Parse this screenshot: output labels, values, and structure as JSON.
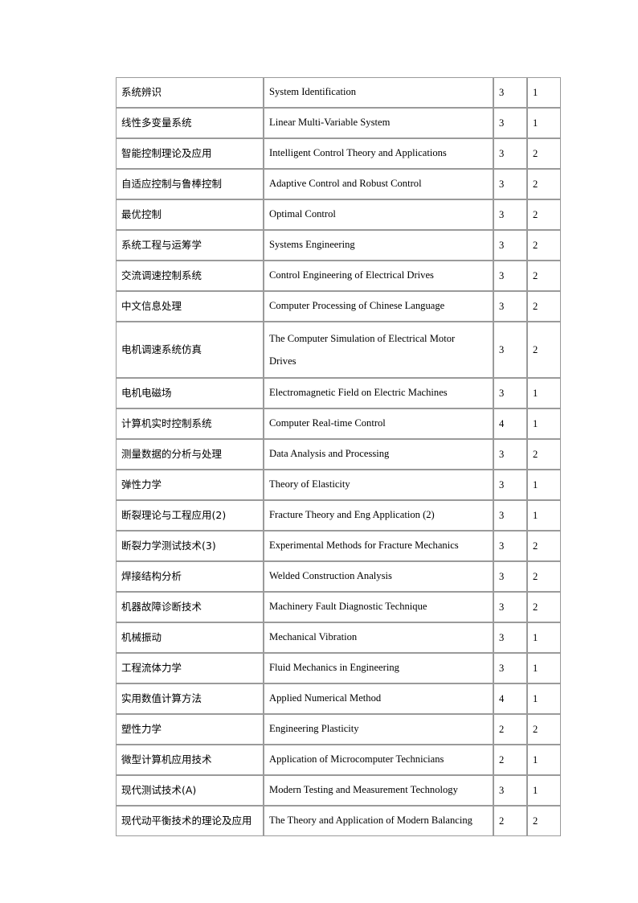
{
  "document": {
    "type": "course-catalog-table",
    "page_background": "#ffffff",
    "text_color": "#000000",
    "border_color": "#9a9a9a"
  },
  "table": {
    "name": "graduate-course-list",
    "columns": [
      {
        "key": "name_cn",
        "role": "course-name-chinese"
      },
      {
        "key": "name_en",
        "role": "course-name-english"
      },
      {
        "key": "credits",
        "role": "credit-hours"
      },
      {
        "key": "term",
        "role": "term"
      }
    ],
    "rows": [
      {
        "name_cn": "系统辨识",
        "name_en": "System Identification",
        "credits": "3",
        "term": "1",
        "tall": false
      },
      {
        "name_cn": "线性多变量系统",
        "name_en": "Linear Multi-Variable System",
        "credits": "3",
        "term": "1",
        "tall": false
      },
      {
        "name_cn": "智能控制理论及应用",
        "name_en": "Intelligent Control Theory and Applications",
        "credits": "3",
        "term": "2",
        "tall": false
      },
      {
        "name_cn": "自适应控制与鲁棒控制",
        "name_en": "Adaptive Control and Robust Control",
        "credits": "3",
        "term": "2",
        "tall": false
      },
      {
        "name_cn": "最优控制",
        "name_en": "Optimal Control",
        "credits": "3",
        "term": "2",
        "tall": false
      },
      {
        "name_cn": "系统工程与运筹学",
        "name_en": "Systems Engineering",
        "credits": "3",
        "term": "2",
        "tall": false
      },
      {
        "name_cn": "交流调速控制系统",
        "name_en": "Control Engineering of Electrical Drives",
        "credits": "3",
        "term": "2",
        "tall": false
      },
      {
        "name_cn": "中文信息处理",
        "name_en": "Computer Processing of Chinese Language",
        "credits": "3",
        "term": "2",
        "tall": false
      },
      {
        "name_cn": "电机调速系统仿真",
        "name_en": "The Computer Simulation of Electrical Motor Drives",
        "name_en_line1": "The Computer Simulation of Electrical  Motor",
        "name_en_line2": "Drives",
        "credits": "3",
        "term": "2",
        "tall": true
      },
      {
        "name_cn": "电机电磁场",
        "name_en": "Electromagnetic Field on Electric Machines",
        "credits": "3",
        "term": "1",
        "tall": false
      },
      {
        "name_cn": "计算机实时控制系统",
        "name_en": "Computer Real-time Control",
        "credits": "4",
        "term": "1",
        "tall": false
      },
      {
        "name_cn": "测量数据的分析与处理",
        "name_en": "Data Analysis and Processing",
        "credits": "3",
        "term": "2",
        "tall": false
      },
      {
        "name_cn": "弹性力学",
        "name_en": "Theory of Elasticity",
        "credits": "3",
        "term": "1",
        "tall": false
      },
      {
        "name_cn": "断裂理论与工程应用(2)",
        "name_en": "Fracture Theory and Eng Application (2)",
        "credits": "3",
        "term": "1",
        "tall": false
      },
      {
        "name_cn": "断裂力学测试技术(3)",
        "name_en": "Experimental Methods for Fracture Mechanics",
        "credits": "3",
        "term": "2",
        "tall": false
      },
      {
        "name_cn": "焊接结构分析",
        "name_en": "Welded Construction Analysis",
        "credits": "3",
        "term": "2",
        "tall": false
      },
      {
        "name_cn": "机器故障诊断技术",
        "name_en": "Machinery Fault Diagnostic Technique",
        "credits": "3",
        "term": "2",
        "tall": false
      },
      {
        "name_cn": "机械振动",
        "name_en": "Mechanical Vibration",
        "credits": "3",
        "term": "1",
        "tall": false
      },
      {
        "name_cn": "工程流体力学",
        "name_en": "Fluid Mechanics in Engineering",
        "credits": "3",
        "term": "1",
        "tall": false
      },
      {
        "name_cn": "实用数值计算方法",
        "name_en": "Applied Numerical Method",
        "credits": "4",
        "term": "1",
        "tall": false
      },
      {
        "name_cn": "塑性力学",
        "name_en": "Engineering Plasticity",
        "credits": "2",
        "term": "2",
        "tall": false
      },
      {
        "name_cn": "微型计算机应用技术",
        "name_en": "Application of Microcomputer Technicians",
        "credits": "2",
        "term": "1",
        "tall": false
      },
      {
        "name_cn": "现代测试技术(A)",
        "name_en": "Modern Testing and Measurement Technology",
        "credits": "3",
        "term": "1",
        "tall": false
      },
      {
        "name_cn": "现代动平衡技术的理论及应用",
        "name_en": "The Theory and Application of Modern Balancing",
        "credits": "2",
        "term": "2",
        "tall": false
      }
    ]
  }
}
